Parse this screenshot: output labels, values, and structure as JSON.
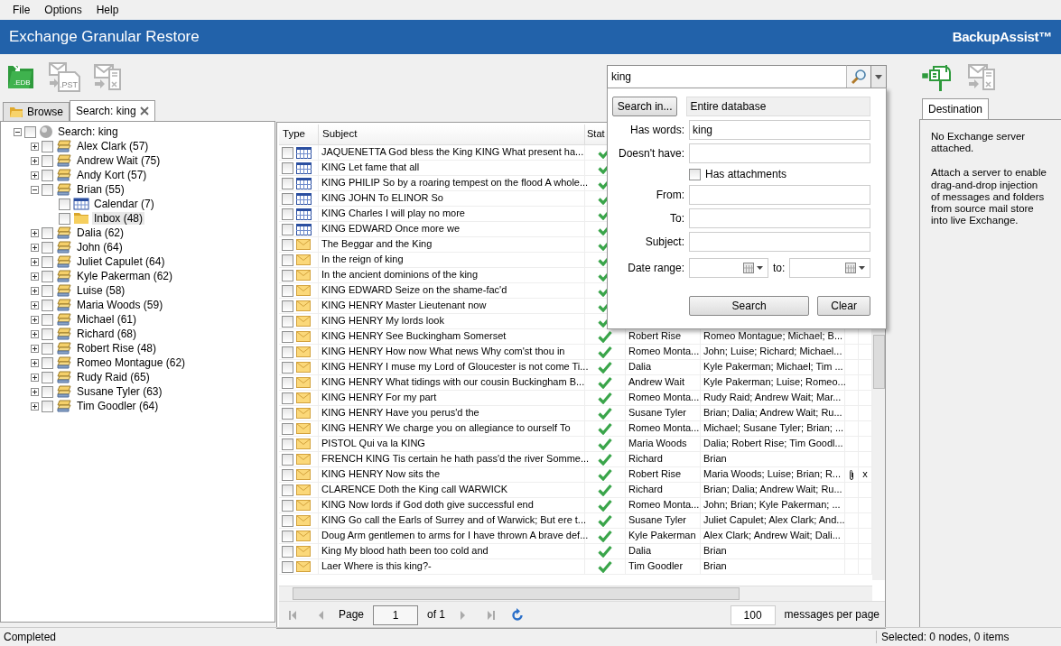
{
  "menu": [
    "File",
    "Options",
    "Help"
  ],
  "window": {
    "title": "Exchange Granular Restore",
    "brand": "BackupAssist™"
  },
  "toolbar": {
    "left_buttons": [
      {
        "kind": "edb",
        "label": ".EDB",
        "disabled": false
      },
      {
        "kind": "pst",
        "label": ".PST",
        "disabled": true
      },
      {
        "kind": "exchange",
        "disabled": true
      }
    ],
    "right_buttons": [
      {
        "kind": "attach-server",
        "disabled": false
      },
      {
        "kind": "exchange",
        "disabled": true
      }
    ]
  },
  "search": {
    "value": "king"
  },
  "search_panel": {
    "search_in_button": "Search in...",
    "scope": "Entire database",
    "fields": [
      {
        "kind": "text",
        "label": "Has words:",
        "value": "king"
      },
      {
        "kind": "text",
        "label": "Doesn't have:"
      },
      {
        "kind": "checkbox",
        "label": "Has attachments",
        "checked": false
      },
      {
        "kind": "text",
        "label": "From:"
      },
      {
        "kind": "text",
        "label": "To:"
      },
      {
        "kind": "text",
        "label": "Subject:"
      },
      {
        "kind": "daterange",
        "label": "Date range:",
        "to_label": "to:"
      }
    ],
    "buttons": [
      "Search",
      "Clear"
    ]
  },
  "left_tabs": [
    {
      "kind": "browse",
      "label": "Browse",
      "selected": false,
      "closable": false
    },
    {
      "kind": "search",
      "label": "Search: king",
      "selected": true,
      "closable": true
    }
  ],
  "tree": {
    "kind": "root",
    "label": "Search: king",
    "checked": false,
    "expanded": true,
    "selected": false,
    "children": [
      {
        "kind": "mailbox",
        "label": "Alex Clark (57)",
        "checked": false,
        "expanded": false,
        "selected": false
      },
      {
        "kind": "mailbox",
        "label": "Andrew Wait (75)",
        "checked": false,
        "expanded": false,
        "selected": false
      },
      {
        "kind": "mailbox",
        "label": "Andy Kort (57)",
        "checked": false,
        "expanded": false,
        "selected": false
      },
      {
        "kind": "mailbox",
        "label": "Brian (55)",
        "checked": false,
        "expanded": true,
        "selected": false,
        "children": [
          {
            "kind": "calendar",
            "label": "Calendar (7)",
            "checked": false,
            "selected": false
          },
          {
            "kind": "folder",
            "label": "Inbox (48)",
            "checked": false,
            "selected": true
          }
        ]
      },
      {
        "kind": "mailbox",
        "label": "Dalia (62)",
        "checked": false,
        "expanded": false,
        "selected": false
      },
      {
        "kind": "mailbox",
        "label": "John (64)",
        "checked": false,
        "expanded": false,
        "selected": false
      },
      {
        "kind": "mailbox",
        "label": "Juliet Capulet (64)",
        "checked": false,
        "expanded": false,
        "selected": false
      },
      {
        "kind": "mailbox",
        "label": "Kyle Pakerman (62)",
        "checked": false,
        "expanded": false,
        "selected": false
      },
      {
        "kind": "mailbox",
        "label": "Luise (58)",
        "checked": false,
        "expanded": false,
        "selected": false
      },
      {
        "kind": "mailbox",
        "label": "Maria Woods (59)",
        "checked": false,
        "expanded": false,
        "selected": false
      },
      {
        "kind": "mailbox",
        "label": "Michael (61)",
        "checked": false,
        "expanded": false,
        "selected": false
      },
      {
        "kind": "mailbox",
        "label": "Richard (68)",
        "checked": false,
        "expanded": false,
        "selected": false
      },
      {
        "kind": "mailbox",
        "label": "Robert Rise (48)",
        "checked": false,
        "expanded": false,
        "selected": false
      },
      {
        "kind": "mailbox",
        "label": "Romeo Montague (62)",
        "checked": false,
        "expanded": false,
        "selected": false
      },
      {
        "kind": "mailbox",
        "label": "Rudy Raid (65)",
        "checked": false,
        "expanded": false,
        "selected": false
      },
      {
        "kind": "mailbox",
        "label": "Susane Tyler (63)",
        "checked": false,
        "expanded": false,
        "selected": false
      },
      {
        "kind": "mailbox",
        "label": "Tim Goodler (64)",
        "checked": false,
        "expanded": false,
        "selected": false
      }
    ]
  },
  "table": {
    "columns": [
      "Type",
      "Subject",
      "Stat"
    ],
    "rows": [
      {
        "kind": "calendar",
        "checked": false,
        "subject": "JAQUENETTA God bless the King KING What present ha...",
        "status_ok": true
      },
      {
        "kind": "calendar",
        "checked": false,
        "subject": "KING Let fame that all",
        "status_ok": true
      },
      {
        "kind": "calendar",
        "checked": false,
        "subject": "KING PHILIP So by a roaring tempest on the flood A whole...",
        "status_ok": true
      },
      {
        "kind": "calendar",
        "checked": false,
        "subject": "KING JOHN To ELINOR So",
        "status_ok": true
      },
      {
        "kind": "calendar",
        "checked": false,
        "subject": "KING Charles I will play no more",
        "status_ok": true
      },
      {
        "kind": "calendar",
        "checked": false,
        "subject": "KING EDWARD Once more we",
        "status_ok": true
      },
      {
        "kind": "mail",
        "checked": false,
        "subject": "The Beggar and the King",
        "status_ok": true
      },
      {
        "kind": "mail",
        "checked": false,
        "subject": "In the reign of king",
        "status_ok": true
      },
      {
        "kind": "mail",
        "checked": false,
        "subject": "In the ancient dominions of the king",
        "status_ok": true
      },
      {
        "kind": "mail",
        "checked": false,
        "subject": "KING EDWARD Seize on the shame-fac'd",
        "status_ok": true
      },
      {
        "kind": "mail",
        "checked": false,
        "subject": "KING HENRY Master Lieutenant now",
        "status_ok": true
      },
      {
        "kind": "mail",
        "checked": false,
        "subject": "KING HENRY My lords look",
        "status_ok": true
      },
      {
        "kind": "mail",
        "checked": false,
        "subject": "KING HENRY See Buckingham Somerset",
        "status_ok": true,
        "from": "Robert Rise",
        "to": "Romeo Montague; Michael; B..."
      },
      {
        "kind": "mail",
        "checked": false,
        "subject": "KING HENRY How now What news Why com'st thou in",
        "status_ok": true,
        "from": "Romeo Monta...",
        "to": "John; Luise; Richard; Michael..."
      },
      {
        "kind": "mail",
        "checked": false,
        "subject": "KING HENRY I muse my Lord of Gloucester is not come Ti...",
        "status_ok": true,
        "from": "Dalia",
        "to": "Kyle Pakerman; Michael; Tim ..."
      },
      {
        "kind": "mail",
        "checked": false,
        "subject": "KING HENRY What tidings with our cousin Buckingham B...",
        "status_ok": true,
        "from": "Andrew Wait",
        "to": "Kyle Pakerman; Luise; Romeo..."
      },
      {
        "kind": "mail",
        "checked": false,
        "subject": "KING HENRY For my part",
        "status_ok": true,
        "from": "Romeo Monta...",
        "to": "Rudy Raid; Andrew Wait; Mar..."
      },
      {
        "kind": "mail",
        "checked": false,
        "subject": "KING HENRY Have you perus'd the",
        "status_ok": true,
        "from": "Susane Tyler",
        "to": "Brian; Dalia; Andrew Wait; Ru..."
      },
      {
        "kind": "mail",
        "checked": false,
        "subject": "KING HENRY We charge you on allegiance to ourself To",
        "status_ok": true,
        "from": "Romeo Monta...",
        "to": "Michael; Susane Tyler; Brian; ..."
      },
      {
        "kind": "mail",
        "checked": false,
        "subject": "PISTOL Qui va la KING",
        "status_ok": true,
        "from": "Maria Woods",
        "to": "Dalia; Robert Rise; Tim Goodl..."
      },
      {
        "kind": "mail",
        "checked": false,
        "subject": "FRENCH KING Tis certain he hath pass'd the river Somme...",
        "status_ok": true,
        "from": "Richard",
        "to": "Brian"
      },
      {
        "kind": "mail",
        "checked": false,
        "subject": "KING HENRY Now sits the",
        "status_ok": true,
        "from": "Robert Rise",
        "to": "Maria Woods; Luise; Brian; R...",
        "has_attachment": true,
        "column_7": "x"
      },
      {
        "kind": "mail",
        "checked": false,
        "subject": "CLARENCE Doth the King call WARWICK",
        "status_ok": true,
        "from": "Richard",
        "to": "Brian; Dalia; Andrew Wait; Ru..."
      },
      {
        "kind": "mail",
        "checked": false,
        "subject": "KING Now lords if God doth give successful end",
        "status_ok": true,
        "from": "Romeo Monta...",
        "to": "John; Brian; Kyle Pakerman; ..."
      },
      {
        "kind": "mail",
        "checked": false,
        "subject": "KING Go call the Earls of Surrey and of Warwick; But ere t...",
        "status_ok": true,
        "from": "Susane Tyler",
        "to": "Juliet Capulet; Alex Clark; And..."
      },
      {
        "kind": "mail",
        "checked": false,
        "subject": "Doug Arm gentlemen to arms for I have thrown A brave def...",
        "status_ok": true,
        "from": "Kyle Pakerman",
        "to": "Alex Clark; Andrew Wait; Dali..."
      },
      {
        "kind": "mail",
        "checked": false,
        "subject": "King My blood hath been too cold and",
        "status_ok": true,
        "from": "Dalia",
        "to": "Brian"
      },
      {
        "kind": "mail",
        "checked": false,
        "subject": "Laer Where is this king?-",
        "status_ok": true,
        "from": "Tim Goodler",
        "to": "Brian"
      }
    ]
  },
  "pager": {
    "page_label": "Page",
    "page": "1",
    "of": "of 1",
    "per_page": "100",
    "per_page_label": "messages per page"
  },
  "destination": {
    "tabs": [
      {
        "label": "Destination",
        "selected": true
      }
    ],
    "paragraphs": [
      "No Exchange server attached.",
      "Attach a server to enable drag-and-drop injection of messages and folders from source mail store into live Exchange."
    ]
  },
  "status_bar": {
    "left": "Completed",
    "right": "Selected: 0 nodes, 0 items"
  }
}
